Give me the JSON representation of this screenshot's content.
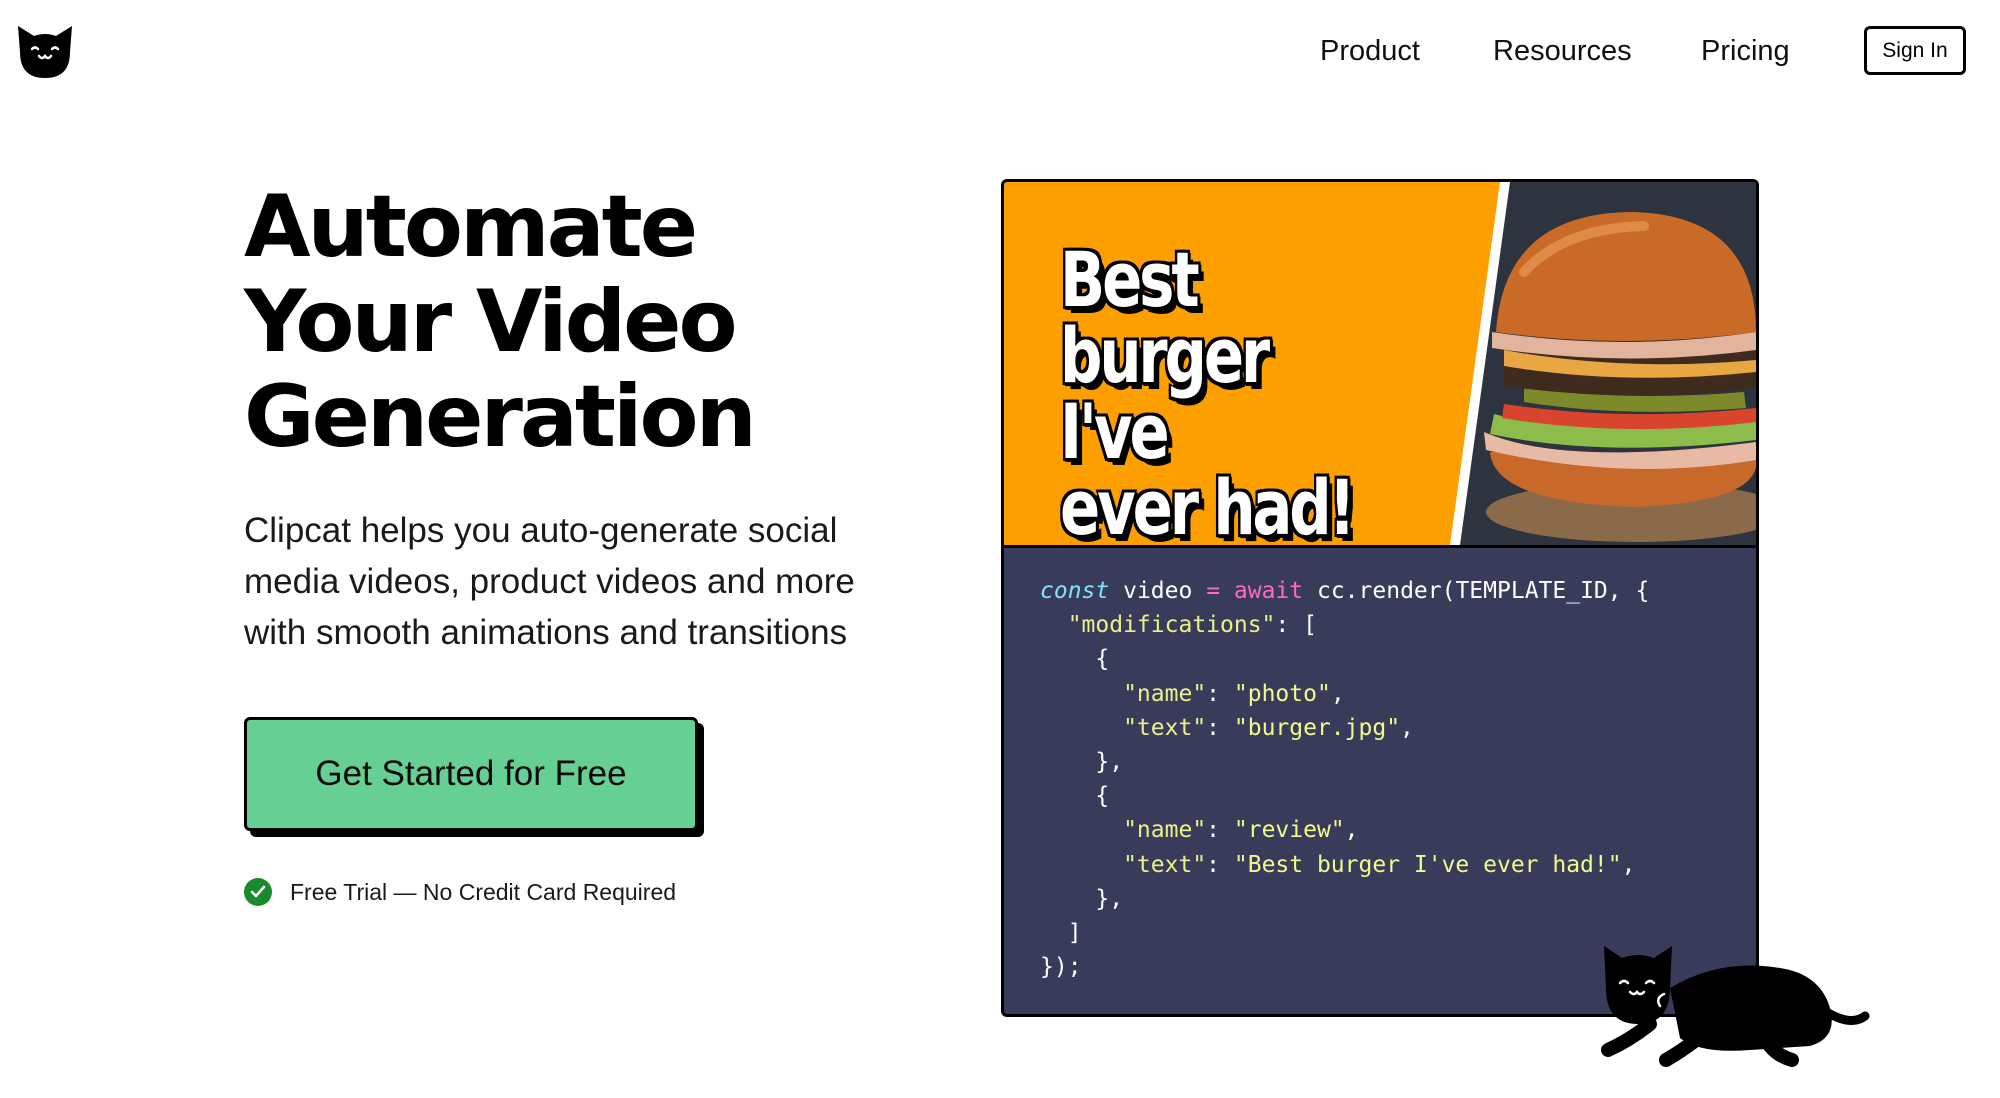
{
  "nav": {
    "logo_alt": "Clipcat",
    "items": [
      {
        "label": "Product"
      },
      {
        "label": "Resources"
      },
      {
        "label": "Pricing"
      }
    ],
    "sign_in_label": "Sign In"
  },
  "hero": {
    "title_lines": [
      "Automate",
      "Your Video",
      "Generation"
    ],
    "subtitle_lines": [
      "Clipcat helps you auto-generate social",
      "media videos, product videos and more",
      "with smooth animations and transitions"
    ],
    "cta_label": "Get Started for Free",
    "trial_note": "Free Trial — No Credit Card Required"
  },
  "demo": {
    "image_caption_lines": [
      "Best",
      "burger I've",
      "ever had!"
    ],
    "code": {
      "line1_kw": "const",
      "line1_var": " video ",
      "line1_op": "=",
      "line1_await": " await",
      "line1_rest": " cc.render(TEMPLATE_ID, {",
      "line2_key": "  \"modifications\"",
      "line2_rest": ": [",
      "line3": "    {",
      "line4_key": "      \"name\"",
      "line4_val": "\"photo\"",
      "line5_key": "      \"text\"",
      "line5_val": "\"burger.jpg\"",
      "line6": "    },",
      "line7": "    {",
      "line8_key": "      \"name\"",
      "line8_val": "\"review\"",
      "line9_key": "      \"text\"",
      "line9_val": "\"Best burger I've ever had!\"",
      "line10": "    },",
      "line11": "  ]",
      "line12": "});"
    }
  },
  "colors": {
    "cta": "#66cf94",
    "code_bg": "#383b5a",
    "image_bg": "#fe9f00",
    "check": "#1a8a2e"
  }
}
